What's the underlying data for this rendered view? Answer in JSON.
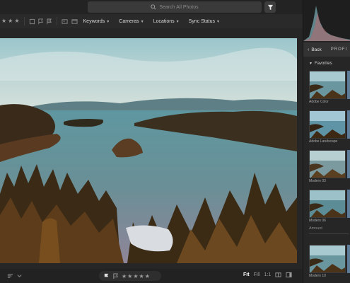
{
  "search": {
    "placeholder": "Search All Photos"
  },
  "filters": {
    "rating_stars": 3,
    "dropdowns": [
      {
        "label": "Keywords"
      },
      {
        "label": "Cameras"
      },
      {
        "label": "Locations"
      },
      {
        "label": "Sync Status"
      }
    ]
  },
  "profiles_panel": {
    "back_label": "Back",
    "section_title": "PROFI",
    "favorites_label": "Favorites",
    "items": [
      {
        "label": "Adobe Color"
      },
      {
        "label": "Adobe Landscape"
      },
      {
        "label": "Modern 03"
      },
      {
        "label": "Modern 06"
      },
      {
        "label": "Modern 10"
      }
    ],
    "amount_label": "Amount"
  },
  "bottom": {
    "zoom_fit": "Fit",
    "zoom_fill": "Fill",
    "zoom_1to1": "1:1",
    "rating_stars": 5
  },
  "colors": {
    "accent": "#ffffff",
    "panel_bg": "#262626",
    "sky": "#8fc0c7",
    "lake": "#4b7c86"
  },
  "icons": {
    "search": "search-icon",
    "filter": "filter-icon",
    "back": "chevron-left-icon"
  }
}
